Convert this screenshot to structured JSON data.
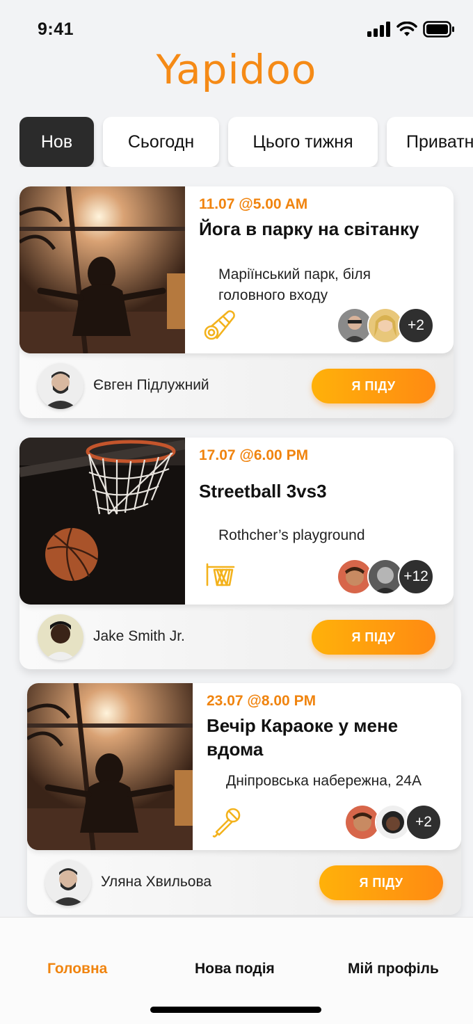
{
  "status_bar": {
    "time": "9:41"
  },
  "app": {
    "logo_text": "Yapidoo",
    "accent": "#f58a16"
  },
  "tabs": [
    {
      "label": "Нов",
      "active": true
    },
    {
      "label": "Сьогодн",
      "active": false
    },
    {
      "label": "Цього тижня",
      "active": false
    },
    {
      "label": "Приватн",
      "active": false
    }
  ],
  "events": [
    {
      "date": "11.07 @5.00 AM",
      "title": "Йога в парку на світанку",
      "place": "Маріїнський парк, біля головного входу",
      "activity_icon": "yoga-mat-icon",
      "extra_participants": "+2",
      "host": "Євген Підлужний",
      "button": "Я ПІДУ"
    },
    {
      "date": "17.07 @6.00 PM",
      "title": "Streetball 3vs3",
      "place": "Rothcher’s playground",
      "activity_icon": "basketball-hoop-icon",
      "extra_participants": "+12",
      "host": "Jake Smith Jr.",
      "button": "Я ПІДУ"
    },
    {
      "date": "23.07 @8.00 PM",
      "title": "Вечір Караоке у мене вдома",
      "place": "Дніпровська набережна, 24А",
      "activity_icon": "microphone-icon",
      "extra_participants": "+2",
      "host": "Уляна Хвильова",
      "button": "Я ПІДУ"
    }
  ],
  "bottom_nav": [
    {
      "label": "Головна",
      "active": true
    },
    {
      "label": "Нова подія",
      "active": false
    },
    {
      "label": "Мій профіль",
      "active": false
    }
  ]
}
